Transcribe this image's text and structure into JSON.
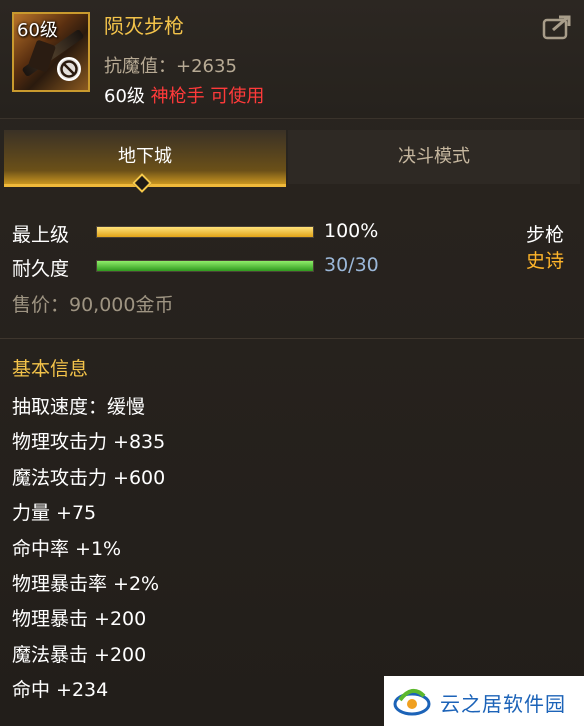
{
  "item": {
    "level_badge": "60级",
    "name": "陨灭步枪",
    "stat": "抗魔值：+2635",
    "req_level": "60级",
    "req_class": "神枪手 可使用"
  },
  "tabs": [
    {
      "label": "地下城",
      "active": true
    },
    {
      "label": "决斗模式",
      "active": false
    }
  ],
  "bars": {
    "grade": {
      "label": "最上级",
      "value_text": "100%",
      "fraction": 1.0
    },
    "durability": {
      "label": "耐久度",
      "value_text": "30/30",
      "fraction": 1.0
    }
  },
  "type": {
    "category": "步枪",
    "rarity": "史诗"
  },
  "price": "售价：90,000金币",
  "info": {
    "title": "基本信息",
    "rows": [
      "抽取速度：缓慢",
      "物理攻击力 +835",
      "魔法攻击力 +600",
      "力量 +75",
      "命中率 +1%",
      "物理暴击率 +2%",
      "物理暴击 +200",
      "魔法暴击 +200",
      "命中 +234"
    ]
  },
  "watermark": {
    "text": "云之居软件园"
  },
  "colors": {
    "gold": "#f3c34a",
    "red": "#ff3a3a",
    "rarity_orange": "#ffb52a",
    "bar_gold": "#e0a318",
    "bar_green": "#2f9a1e"
  },
  "icons": {
    "share": "share-icon",
    "forbid": "forbid-icon"
  }
}
